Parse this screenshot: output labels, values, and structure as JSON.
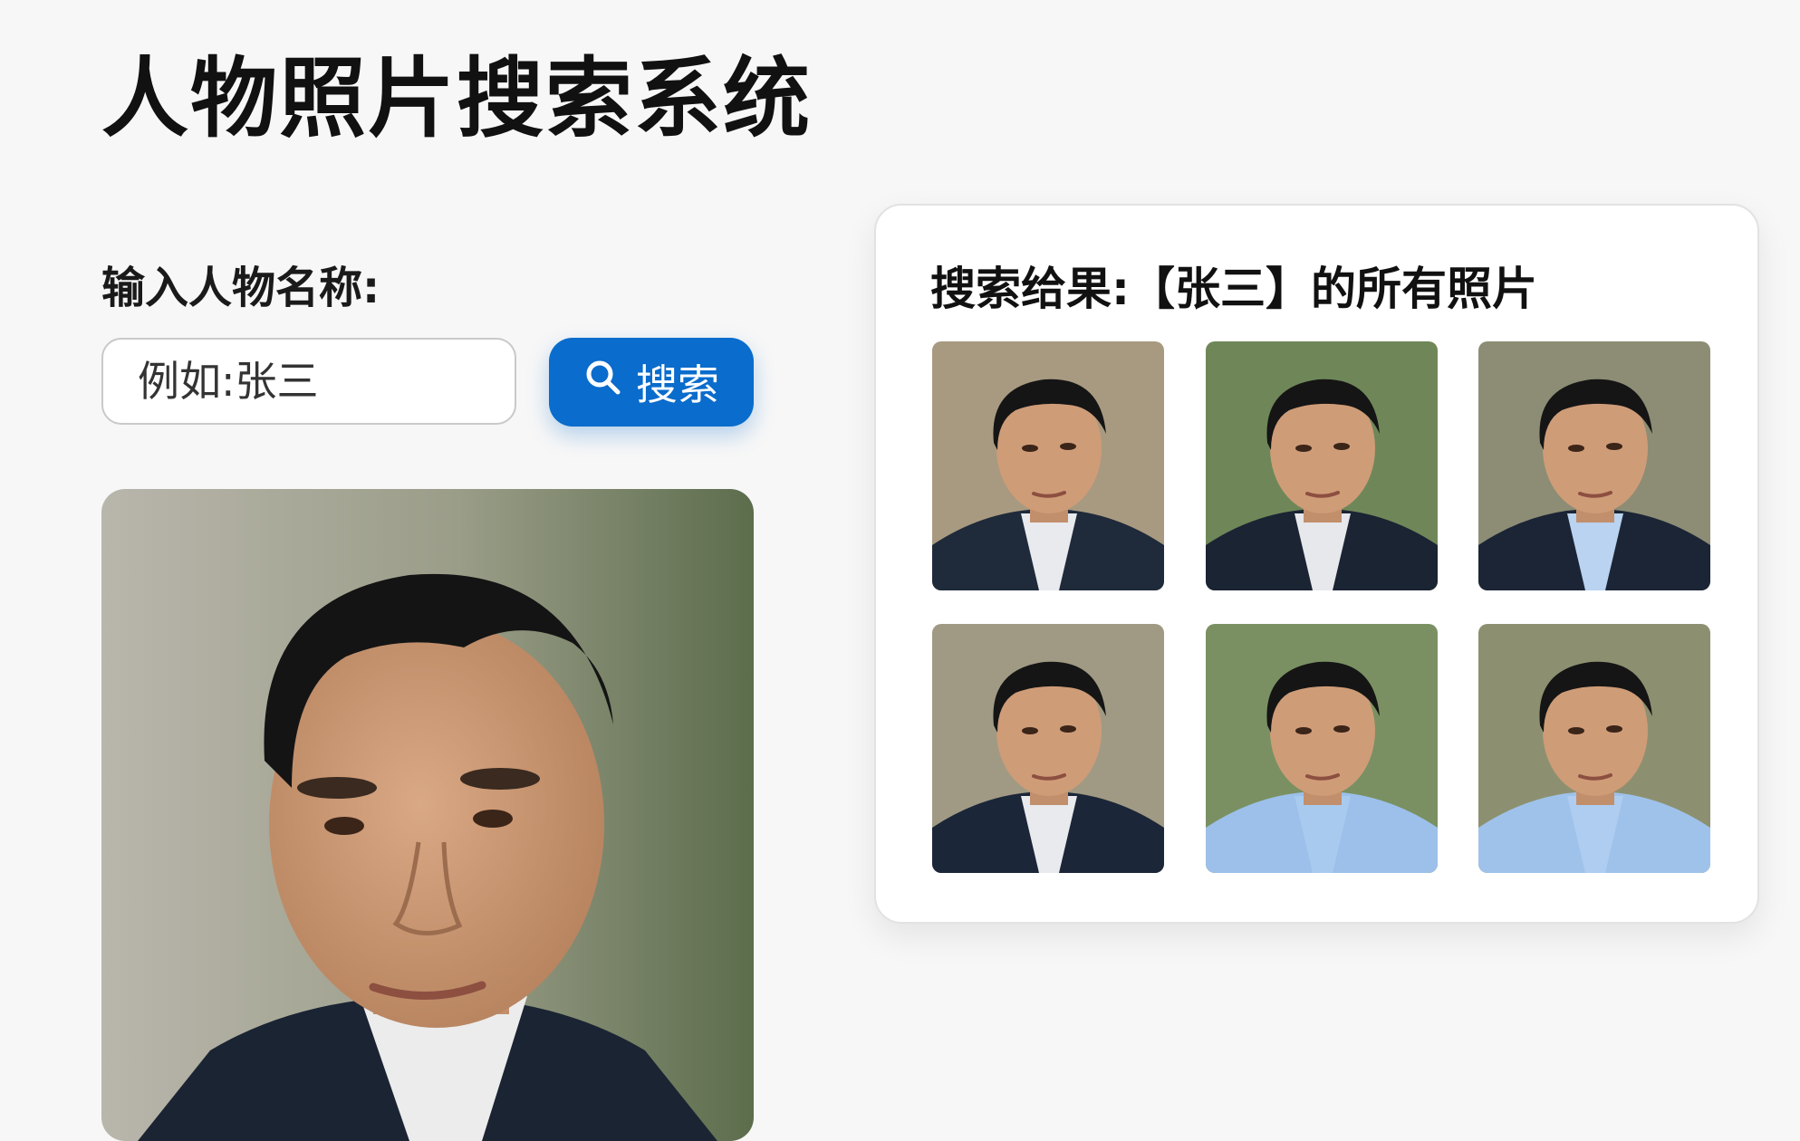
{
  "header": {
    "title": "人物照片搜索系统"
  },
  "search": {
    "label": "输入人物名称:",
    "placeholder": "例如:张三",
    "button_label": "搜索",
    "button_icon": "search-icon"
  },
  "main_photo": {
    "alt": "张三"
  },
  "results": {
    "title": "搜索给果:【张三】的所有照片",
    "photos": [
      {
        "background": "#a89a80",
        "jacket": "#1f2a3a",
        "shirt": "#e8eaee"
      },
      {
        "background": "#6f8758",
        "jacket": "#1b2433",
        "shirt": "#e6e8ec"
      },
      {
        "background": "#8c8d74",
        "jacket": "#1c2536",
        "shirt": "#b9d3f0"
      },
      {
        "background": "#a09a84",
        "jacket": "#1b2638",
        "shirt": "#e8eaee"
      },
      {
        "background": "#7a9062",
        "jacket": "#9cc0ea",
        "shirt": "#a9caef"
      },
      {
        "background": "#8d9070",
        "jacket": "#9fc2ea",
        "shirt": "#aecdf0"
      }
    ]
  },
  "colors": {
    "accent": "#0a6ccc",
    "page_background": "#f7f7f7",
    "card_background": "#ffffff"
  }
}
